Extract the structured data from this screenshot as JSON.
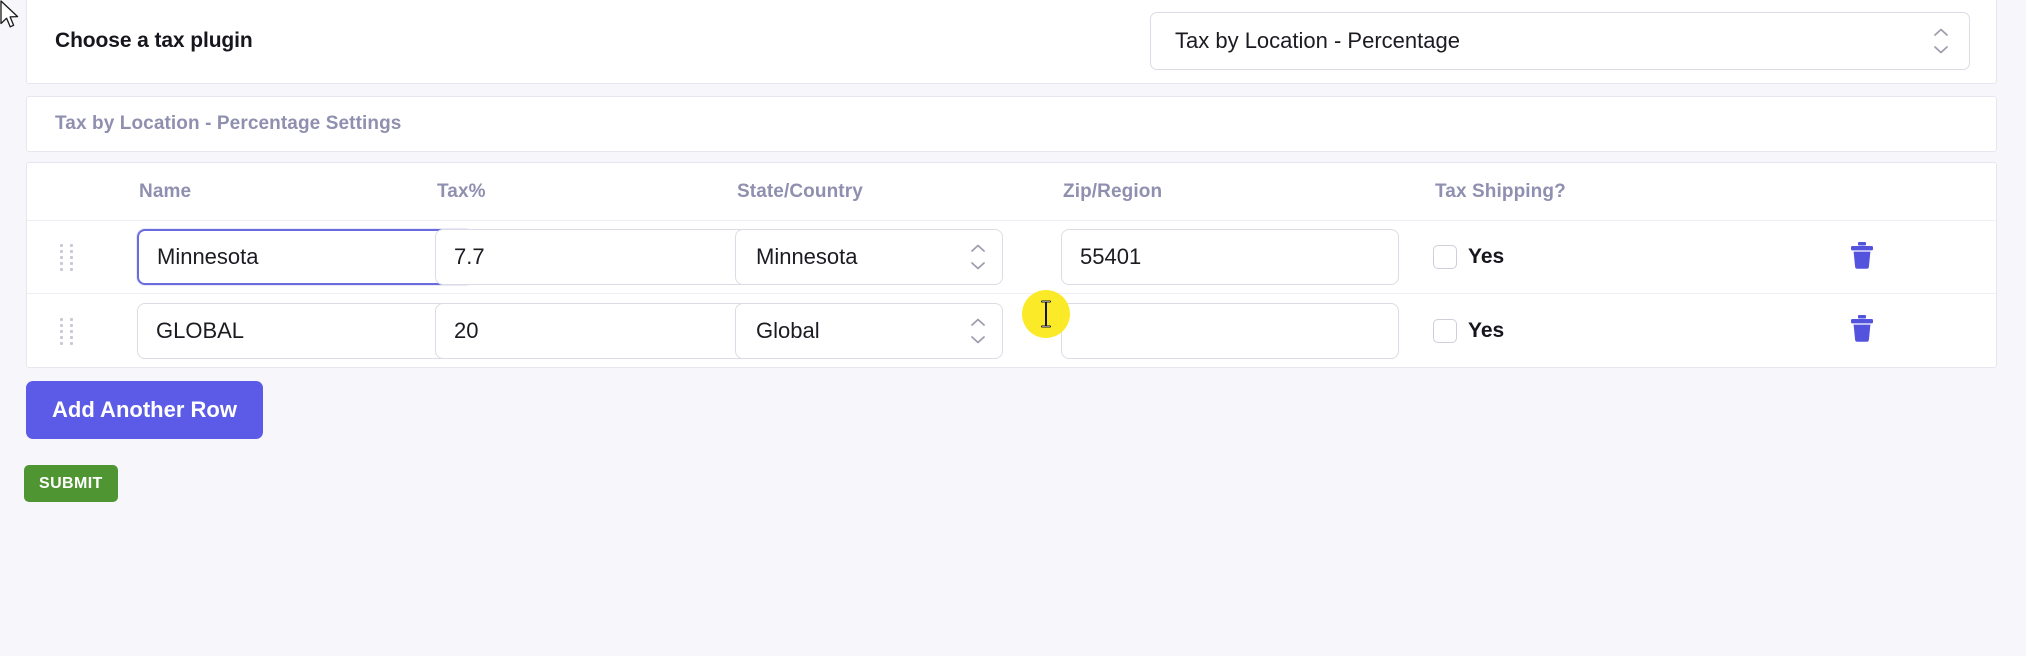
{
  "plugin_chooser": {
    "label": "Choose a tax plugin",
    "selected": "Tax by Location - Percentage",
    "options": [
      "Tax by Location - Percentage"
    ],
    "icon": "chevron-updown-icon"
  },
  "settings_panel": {
    "title": "Tax by Location - Percentage Settings"
  },
  "table": {
    "headers": {
      "name": "Name",
      "tax": "Tax%",
      "state": "State/Country",
      "zip": "Zip/Region",
      "shipping": "Tax Shipping?"
    },
    "rows": [
      {
        "name": "Minnesota",
        "tax": "7.7",
        "state": "Minnesota",
        "zip": "55401",
        "zip_placeholder": "",
        "shipping_label": "Yes",
        "shipping_checked": false,
        "name_focused": true,
        "delete_icon": "trash-icon",
        "drag_icon": "drag-handle-icon"
      },
      {
        "name": "GLOBAL",
        "tax": "20",
        "state": "Global",
        "zip": "",
        "zip_placeholder": "",
        "shipping_label": "Yes",
        "shipping_checked": false,
        "name_focused": false,
        "delete_icon": "trash-icon",
        "drag_icon": "drag-handle-icon"
      }
    ]
  },
  "actions": {
    "add_row_label": "Add Another Row",
    "submit_label": "SUBMIT"
  },
  "colors": {
    "page_background": "#f6f6fb",
    "panel_background": "#ffffff",
    "panel_border": "#e6e6f0",
    "header_text": "#8f8fb0",
    "accent_indigo": "#5b5be8",
    "focus_border": "#6b6be0",
    "trash_icon": "#5353dd",
    "submit_green": "#4f9632",
    "click_highlight": "#fbe816"
  }
}
